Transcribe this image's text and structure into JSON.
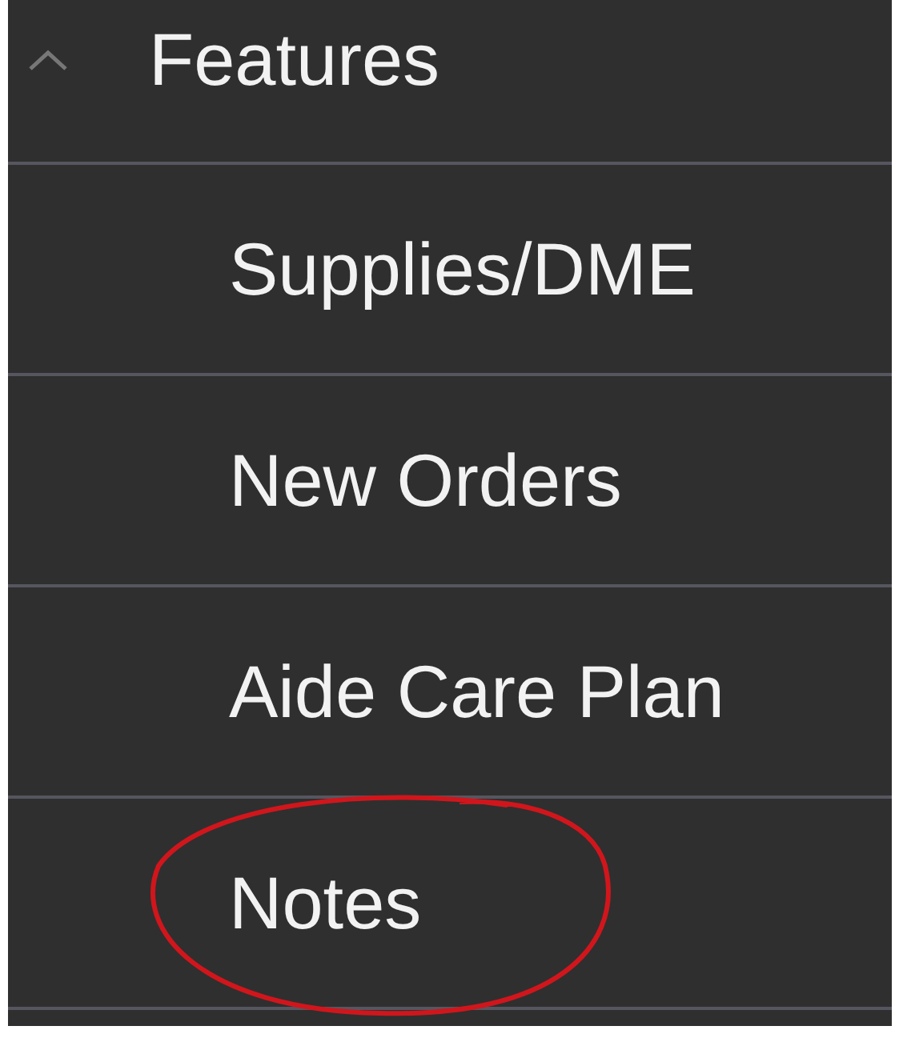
{
  "section": {
    "title": "Features",
    "expanded": true
  },
  "items": [
    {
      "label": "Supplies/DME",
      "circled": false
    },
    {
      "label": "New Orders",
      "circled": false
    },
    {
      "label": "Aide Care Plan",
      "circled": false
    },
    {
      "label": "Notes",
      "circled": true
    }
  ]
}
